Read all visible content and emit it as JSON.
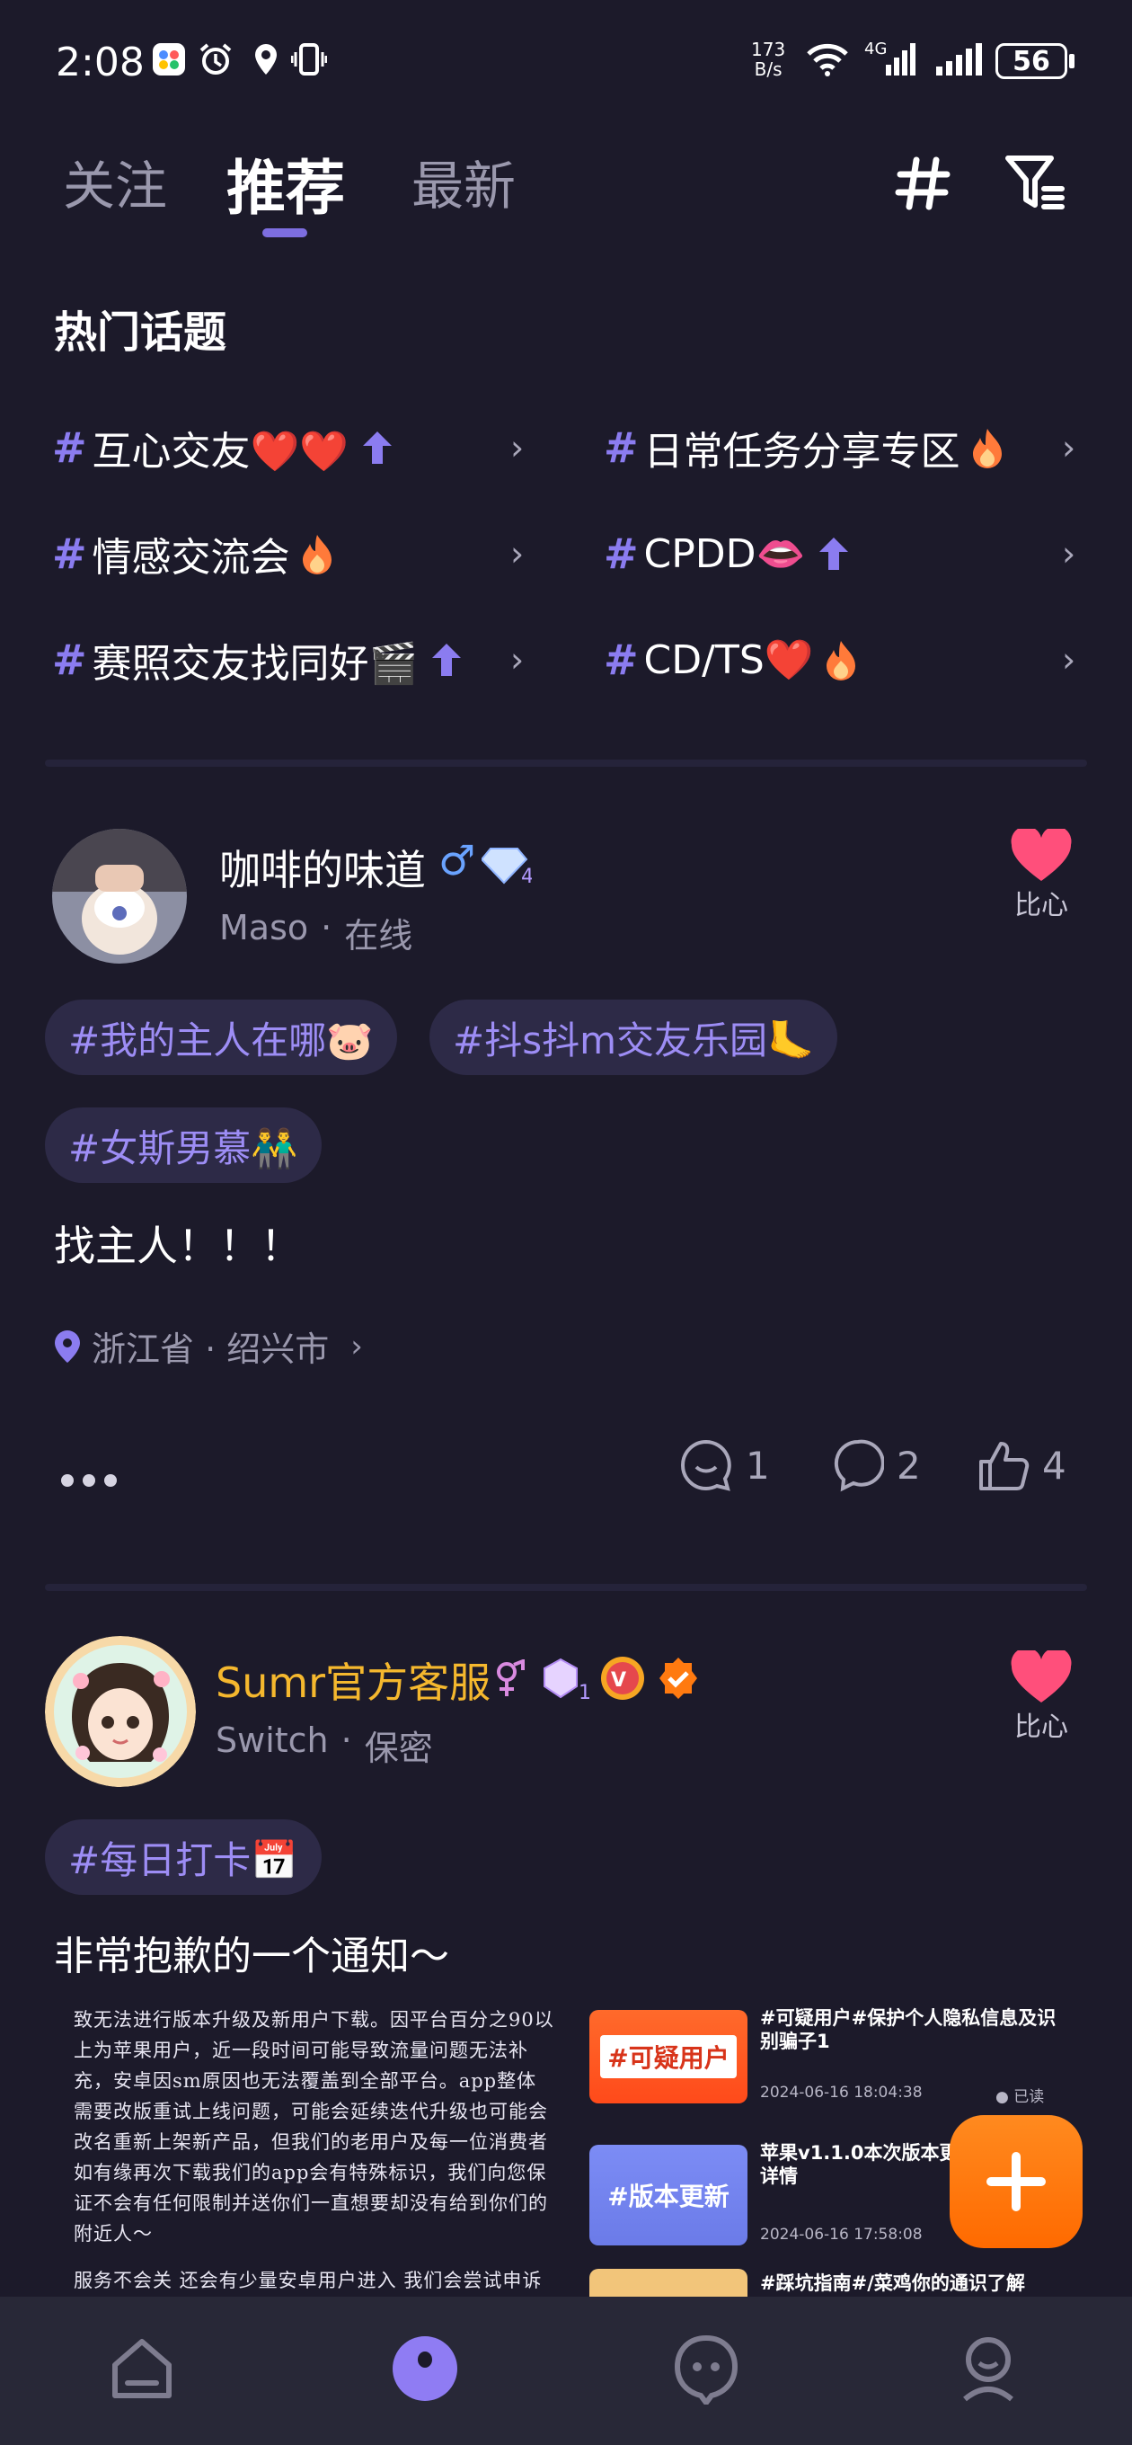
{
  "status_bar": {
    "time": "2:08",
    "net_speed_top": "173",
    "net_speed_unit": "B/s",
    "network_type": "4G",
    "battery": "56"
  },
  "tabs": [
    {
      "label": "关注"
    },
    {
      "label": "推荐"
    },
    {
      "label": "最新"
    }
  ],
  "hot_topics": {
    "title": "热门话题",
    "left": [
      {
        "label": "互心交友❤️❤️",
        "badge": "up"
      },
      {
        "label": "情感交流会",
        "badge": "fire"
      },
      {
        "label": "赛照交友找同好🎬",
        "badge": "up"
      }
    ],
    "right": [
      {
        "label": "日常任务分享专区",
        "badge": "fire"
      },
      {
        "label": "CPDD👄",
        "badge": "up"
      },
      {
        "label": "CD/TS❤️",
        "badge": "fire"
      }
    ]
  },
  "post1": {
    "username": "咖啡的味道",
    "gender_icon": "♂",
    "level": "4",
    "role": "Maso",
    "status": "在线",
    "like_label": "比心",
    "tags": [
      "#我的主人在哪🐷",
      "#抖s抖m交友乐园🦶",
      "#女斯男慕👬"
    ],
    "content": "找主人！！！",
    "location": "浙江省 · 绍兴市",
    "comments": "1",
    "replies": "2",
    "likes": "4"
  },
  "post2": {
    "username": "Sumr官方客服",
    "level": "1",
    "role": "Switch",
    "status": "保密",
    "like_label": "比心",
    "tags": [
      "#每日打卡📅"
    ],
    "title": "非常抱歉的一个通知～",
    "image_text_1": "致无法进行版本升级及新用户下载。因平台百分之90以上为苹果用户，近一段时间可能导致流量问题无法补充，安卓因sm原因也无法覆盖到全部平台。app整体需要改版重试上线问题，可能会延续迭代升级也可能会改名重新上架新产品，但我们的老用户及每一位消费者如有缘再次下载我们的app会有特殊标识，我们向您保证不会有任何限制并送你们一直想要却没有给到你们的附近人～",
    "image_text_2": "服务不会关 还会有少量安卓用户进入 我们会尝试申诉 改版或重新建立新产品早日回归 Sumr上线从",
    "items": [
      {
        "thumb": "#可疑用户",
        "title": "#可疑用户#保护个人隐私信息及识别骗子1",
        "date": "2024-06-16 18:04:38",
        "read": "已读"
      },
      {
        "thumb": "#版本更新",
        "title": "苹果v1.1.0本次版本更新详情",
        "date": "2024-06-16 17:58:08",
        "read": ""
      },
      {
        "thumb": "",
        "title": "#踩坑指南#/菜鸡你的通识了解",
        "date": "",
        "read": ""
      }
    ]
  },
  "colors": {
    "background": "#1c1a2a",
    "accent": "#8b7cf0",
    "heart": "#ff4f7b",
    "fab": "#ff7a10",
    "gold_name": "#f5b82e"
  }
}
